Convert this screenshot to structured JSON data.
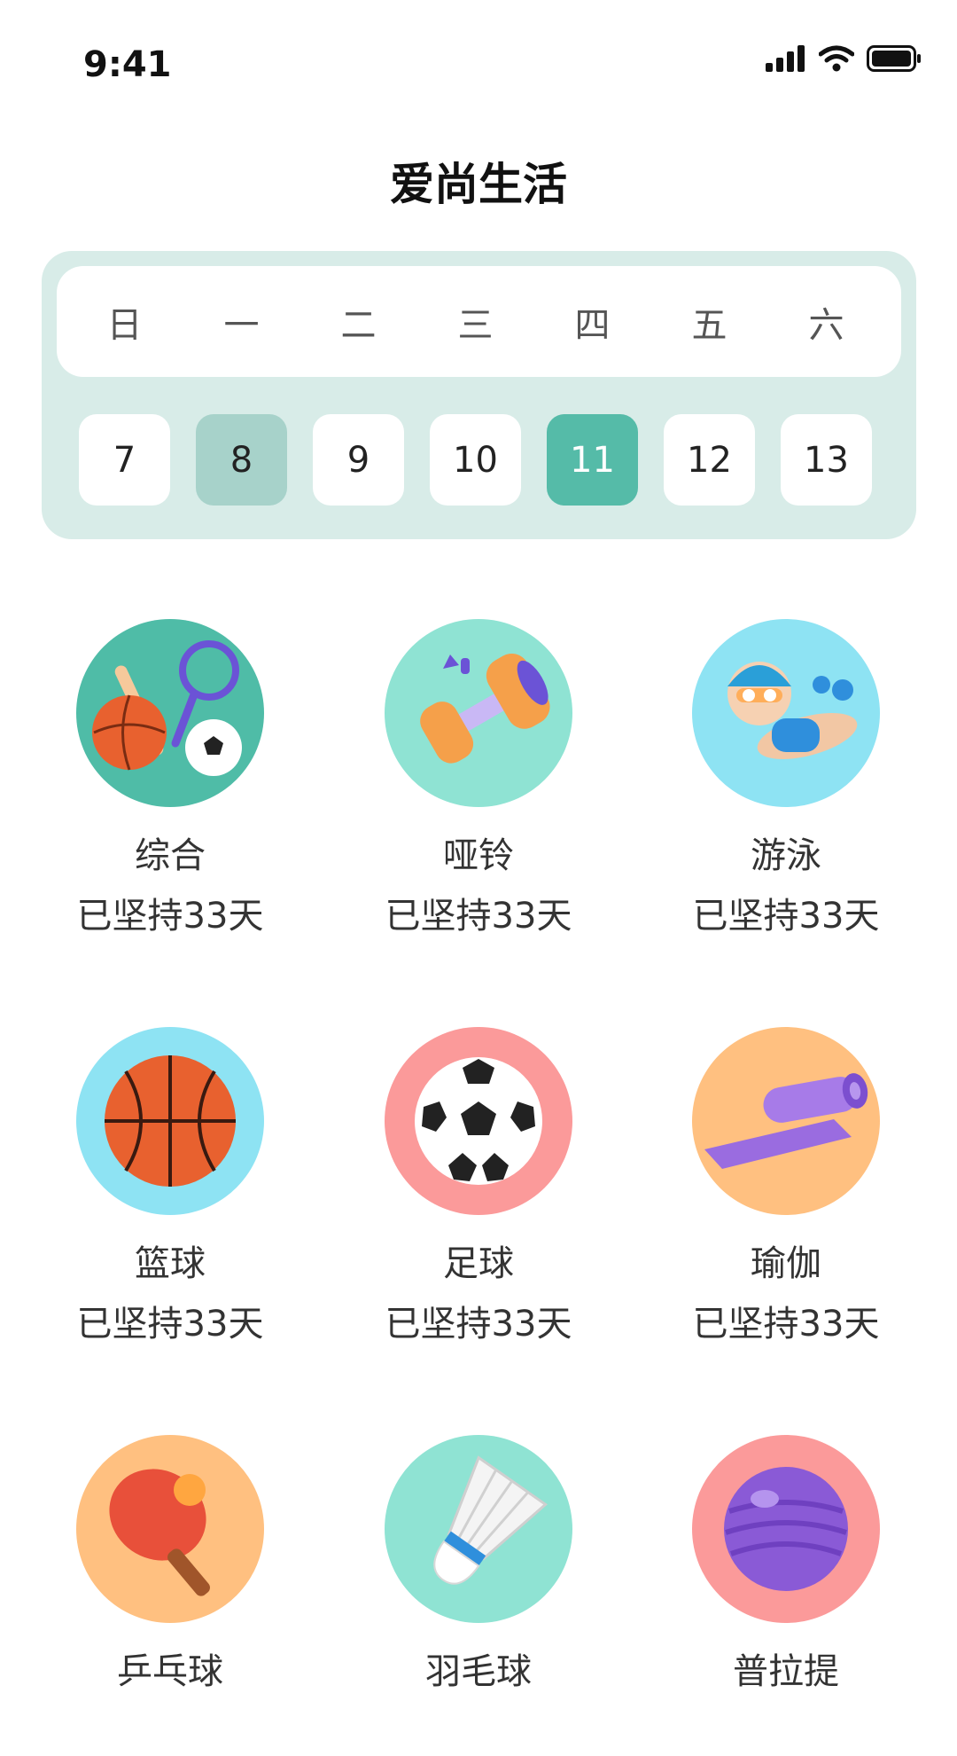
{
  "status_bar": {
    "time": "9:41",
    "icons": [
      "signal-icon",
      "wifi-icon",
      "battery-icon"
    ]
  },
  "header": {
    "title": "爱尚生活"
  },
  "calendar": {
    "weekdays": [
      "日",
      "一",
      "二",
      "三",
      "四",
      "五",
      "六"
    ],
    "dates": [
      "7",
      "8",
      "9",
      "10",
      "11",
      "12",
      "13"
    ],
    "highlighted_date": "8",
    "active_date": "11",
    "colors": {
      "card": "#d8ece8",
      "active": "#55bba8",
      "highlight": "#a7d2ca"
    }
  },
  "sports": [
    {
      "name": "综合",
      "days": "已坚持33天",
      "icon": "multi-sport-icon",
      "bg": "#4fbca7"
    },
    {
      "name": "哑铃",
      "days": "已坚持33天",
      "icon": "dumbbell-icon",
      "bg": "#8fe3d3"
    },
    {
      "name": "游泳",
      "days": "已坚持33天",
      "icon": "swimmer-icon",
      "bg": "#8ee3f3"
    },
    {
      "name": "篮球",
      "days": "已坚持33天",
      "icon": "basketball-icon",
      "bg": "#8ee3f3"
    },
    {
      "name": "足球",
      "days": "已坚持33天",
      "icon": "soccer-ball-icon",
      "bg": "#fb9a9a"
    },
    {
      "name": "瑜伽",
      "days": "已坚持33天",
      "icon": "yoga-mat-icon",
      "bg": "#ffc080"
    },
    {
      "name": "乒乓球",
      "days": "",
      "icon": "ping-pong-icon",
      "bg": "#ffc080"
    },
    {
      "name": "羽毛球",
      "days": "",
      "icon": "shuttlecock-icon",
      "bg": "#8fe3d3"
    },
    {
      "name": "普拉提",
      "days": "",
      "icon": "pilates-ball-icon",
      "bg": "#fb9a9a"
    }
  ]
}
